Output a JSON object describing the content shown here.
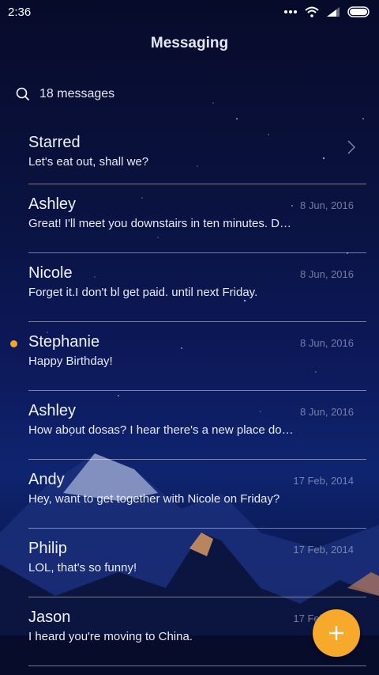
{
  "status": {
    "time": "2:36",
    "icons": [
      "more-dots-icon",
      "wifi-icon",
      "signal-icon",
      "battery-icon"
    ]
  },
  "header": {
    "title": "Messaging"
  },
  "search": {
    "label": "18 messages",
    "icon": "search-icon"
  },
  "conversations": [
    {
      "name": "Starred",
      "snippet": "Let's eat out, shall we?",
      "date": "",
      "unread": false,
      "chevron": true
    },
    {
      "name": "Ashley",
      "snippet": "Great! I'll meet you downstairs in ten minutes. D…",
      "date": "8 Jun, 2016",
      "unread": false
    },
    {
      "name": "Nicole",
      "snippet": "Forget it.I don't bl get paid. until next Friday.",
      "date": "8 Jun, 2016",
      "unread": false
    },
    {
      "name": "Stephanie",
      "snippet": "Happy Birthday!",
      "date": "8 Jun, 2016",
      "unread": true
    },
    {
      "name": "Ashley",
      "snippet": "How about dosas? I hear there's a new place do…",
      "date": "8 Jun, 2016",
      "unread": false
    },
    {
      "name": "Andy",
      "snippet": "Hey, want to get together with Nicole on Friday?",
      "date": "17 Feb, 2014",
      "unread": false
    },
    {
      "name": "Philip",
      "snippet": "LOL, that's so funny!",
      "date": "17 Feb, 2014",
      "unread": false
    },
    {
      "name": "Jason",
      "snippet": "I heard you're moving to China.",
      "date": "17 Feb, 2014",
      "unread": false
    }
  ],
  "fab": {
    "icon": "plus-icon",
    "color": "#f6a92a"
  },
  "colors": {
    "unread_dot": "#f5a623",
    "accent": "#f6a92a"
  }
}
